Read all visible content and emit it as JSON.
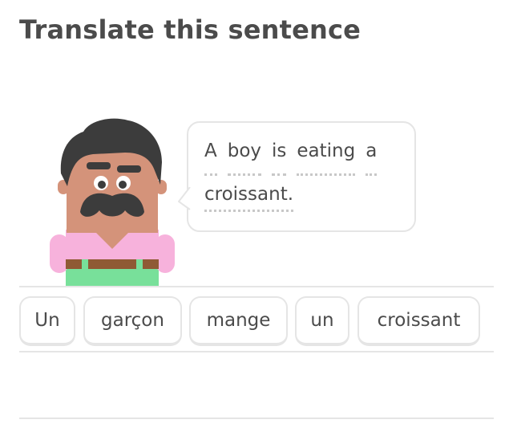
{
  "header": {
    "title": "Translate this sentence"
  },
  "prompt": {
    "line1": [
      "A",
      "boy",
      "is",
      "eating",
      "a"
    ],
    "line2": [
      "croissant."
    ]
  },
  "word_bank": [
    "Un",
    "garçon",
    "mange",
    "un",
    "croissant"
  ],
  "colors": {
    "text": "#4b4b4b",
    "border": "#e5e5e5",
    "skin": "#d4937a",
    "hair": "#3c3c3c",
    "shirt": "#f7b2dc",
    "belt": "#8f5a34",
    "pants": "#78e09a"
  }
}
